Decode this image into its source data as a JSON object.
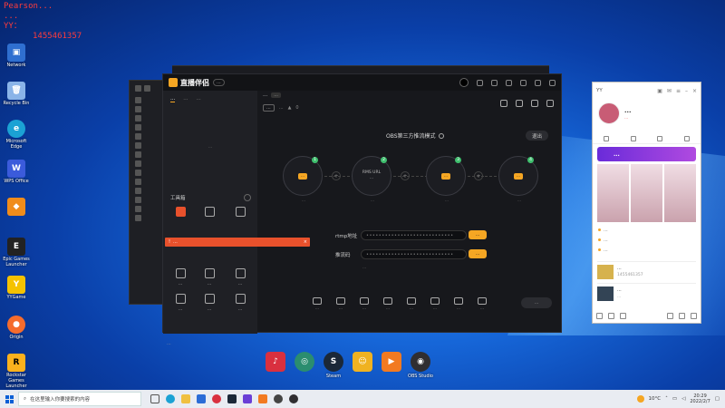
{
  "overlay": {
    "line1": "Pearson...",
    "line2": "...",
    "line3": "YY：",
    "line4": "1455461357"
  },
  "desktop_icons": [
    {
      "label": "Network",
      "color": "#2f6fd0"
    },
    {
      "label": "Recycle Bin",
      "color": "#8ab4e8"
    },
    {
      "label": "Microsoft Edge",
      "color": "#1ba2d4"
    },
    {
      "label": "WPS Office",
      "color": "#3b5bdb"
    },
    {
      "label": "",
      "color": "#f08c1b"
    },
    {
      "label": "Epic Games Launcher",
      "color": "#222"
    },
    {
      "label": "YYGame",
      "color": "#f5c200"
    },
    {
      "label": "Origin",
      "color": "#f56c2d"
    },
    {
      "label": "Rockstar Games Launcher",
      "color": "#fbb11d"
    }
  ],
  "dock": [
    {
      "label": "",
      "color": "#d9303f"
    },
    {
      "label": "",
      "color": "#2b8d6f"
    },
    {
      "label": "Steam",
      "color": "#1b2838"
    },
    {
      "label": "",
      "color": "#f0b221"
    },
    {
      "label": "",
      "color": "#f27a21"
    },
    {
      "label": "OBS Studio",
      "color": "#302e31"
    }
  ],
  "main": {
    "app_name": "直播伴侣",
    "version": "...",
    "left_tabs": [
      "...",
      "...",
      "..."
    ],
    "left_empty": "...",
    "tools_title": "工具箱",
    "tools": [
      {
        "label": ""
      },
      {
        "label": ""
      },
      {
        "label": ""
      },
      {
        "label": "..."
      },
      {
        "label": "..."
      },
      {
        "label": "..."
      },
      {
        "label": "..."
      },
      {
        "label": "..."
      },
      {
        "label": "..."
      }
    ],
    "toast": "...",
    "toast_close": "×",
    "bottom_note": "...",
    "stream_title": "...",
    "stream_tag": "...",
    "meta_pill": "...",
    "meta_text": "...",
    "meta_count": "0",
    "obs_title": "OBS第三方推流模式",
    "exit": "退出",
    "steps": [
      {
        "num": "1",
        "badge": "...",
        "desc": "..."
      },
      {
        "num": "2",
        "badge": "RMS URL",
        "sub": "...",
        "desc": "..."
      },
      {
        "num": "3",
        "badge": "...",
        "desc": "..."
      },
      {
        "num": "4",
        "badge": "...",
        "desc": "..."
      }
    ],
    "rtmp_label": "rtmp地址",
    "rtmp_value": "••••••••••••••••••••••••••••",
    "key_label": "推流码",
    "key_value": "••••••••••••••••••••••••••••",
    "copy": "...",
    "hint": "...",
    "bottom_tools": [
      "...",
      "...",
      "...",
      "...",
      "...",
      "...",
      "...",
      "..."
    ],
    "start_live": "..."
  },
  "yy": {
    "title": "YY",
    "name": "...",
    "sub": "...",
    "banner": "...",
    "list": [
      "...",
      "...",
      "..."
    ],
    "cards": [
      {
        "title": "...",
        "sub": "1455461357"
      },
      {
        "title": "...",
        "sub": "..."
      }
    ]
  },
  "taskbar": {
    "search_placeholder": "在这里输入你要搜索的内容",
    "weather": "10°C",
    "time": "20:29",
    "date": "2022/2/7"
  }
}
